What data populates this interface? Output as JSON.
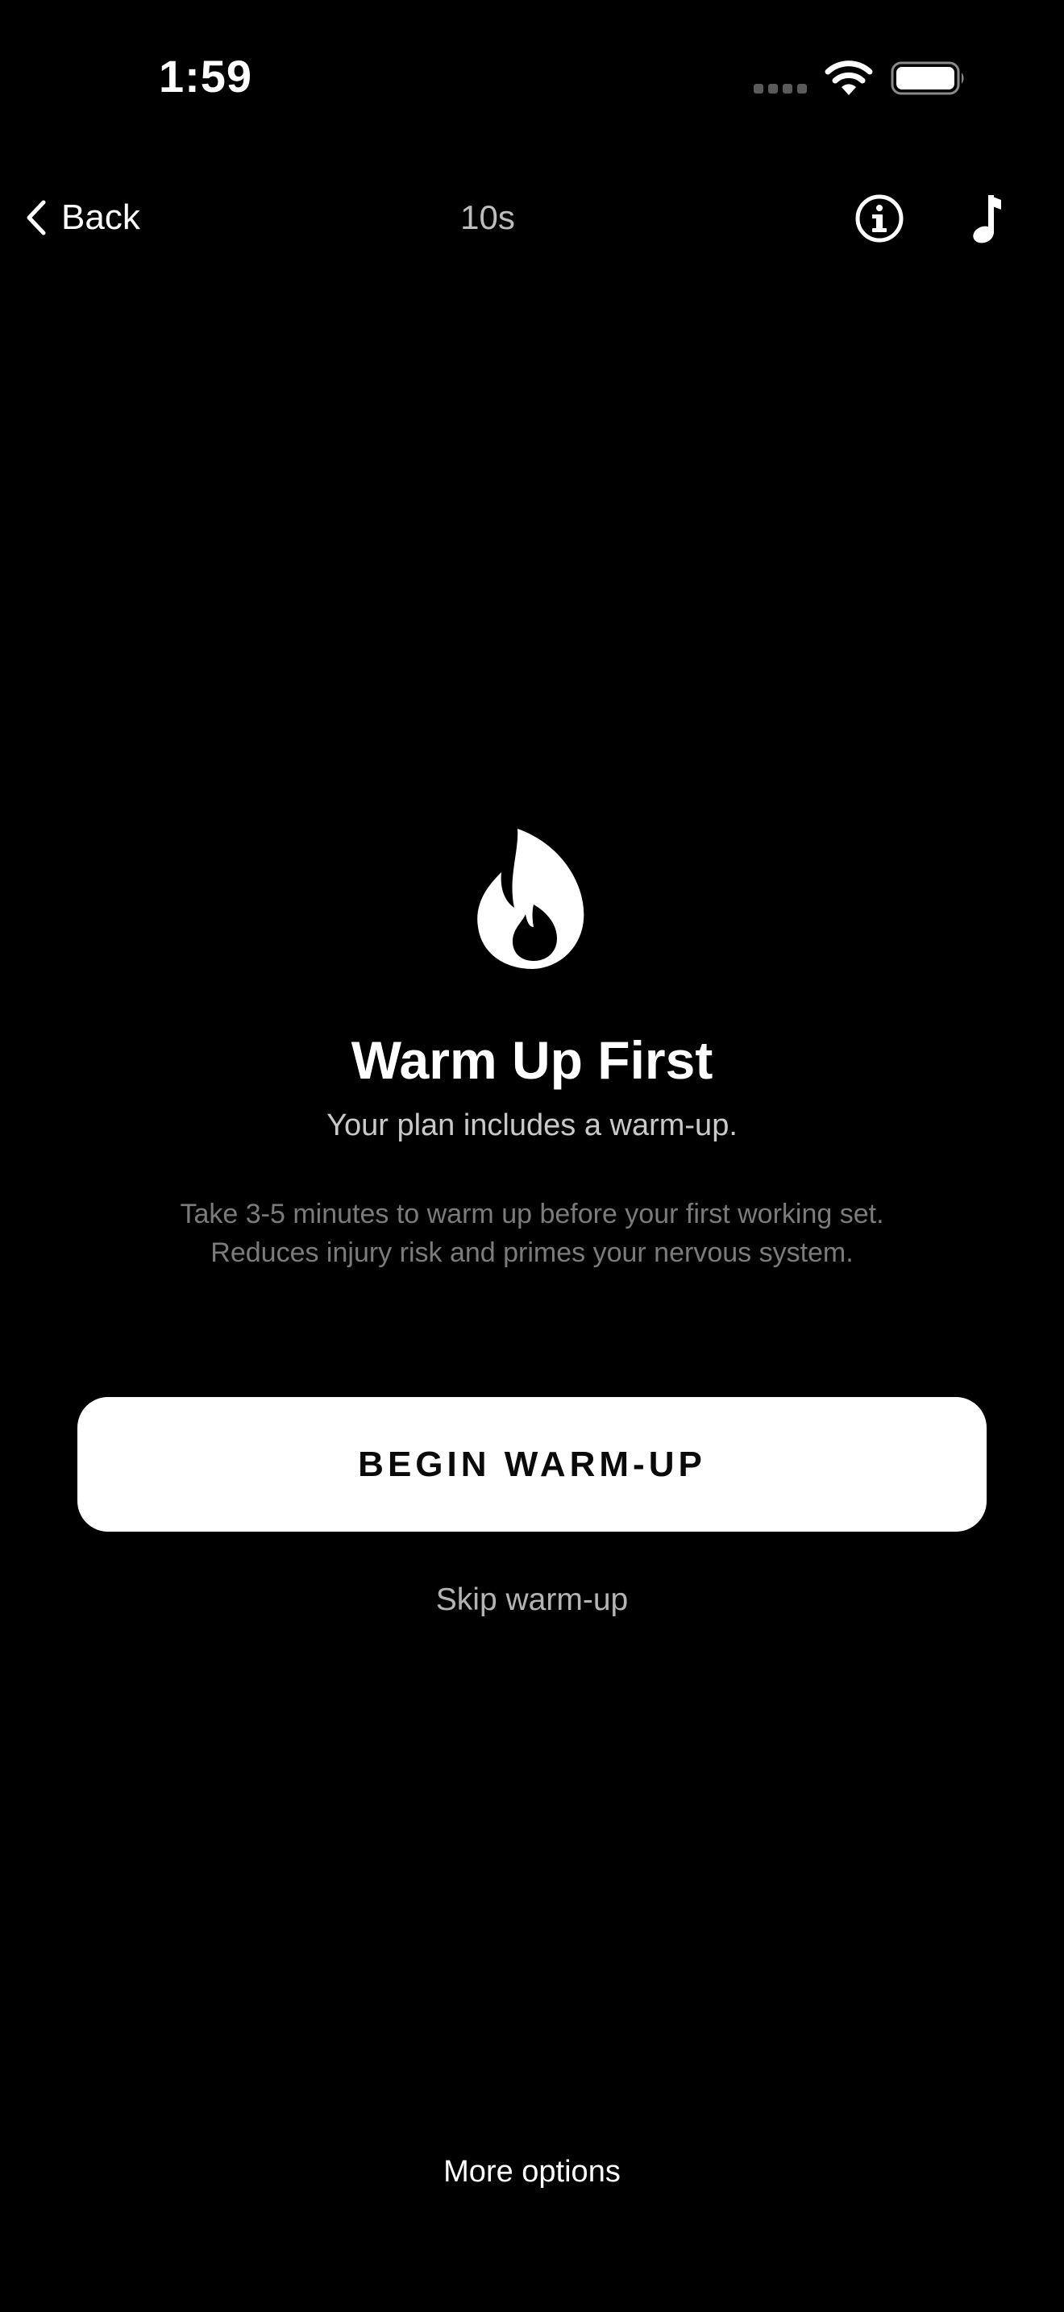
{
  "status_bar": {
    "time": "1:59",
    "icons": [
      "cellular-signal-icon",
      "wifi-icon",
      "battery-icon"
    ]
  },
  "nav": {
    "back_label": "Back",
    "timer": "10s",
    "icons": [
      "chevron-left-icon",
      "info-icon",
      "music-note-icon"
    ]
  },
  "hero": {
    "icon": "flame-icon",
    "title": "Warm Up First",
    "subtitle": "Your plan includes a warm-up.",
    "description_line1": "Take 3-5 minutes to warm up before your first working set.",
    "description_line2": "Reduces injury risk and primes your nervous system."
  },
  "actions": {
    "begin_label": "BEGIN WARM-UP",
    "skip_label": "Skip warm-up",
    "more_label": "More options"
  },
  "colors": {
    "background": "#000000",
    "primary_text": "#ffffff",
    "button_bg": "#ffffff",
    "button_text": "#0a0a0a",
    "muted_text": "#7b7b7b"
  }
}
